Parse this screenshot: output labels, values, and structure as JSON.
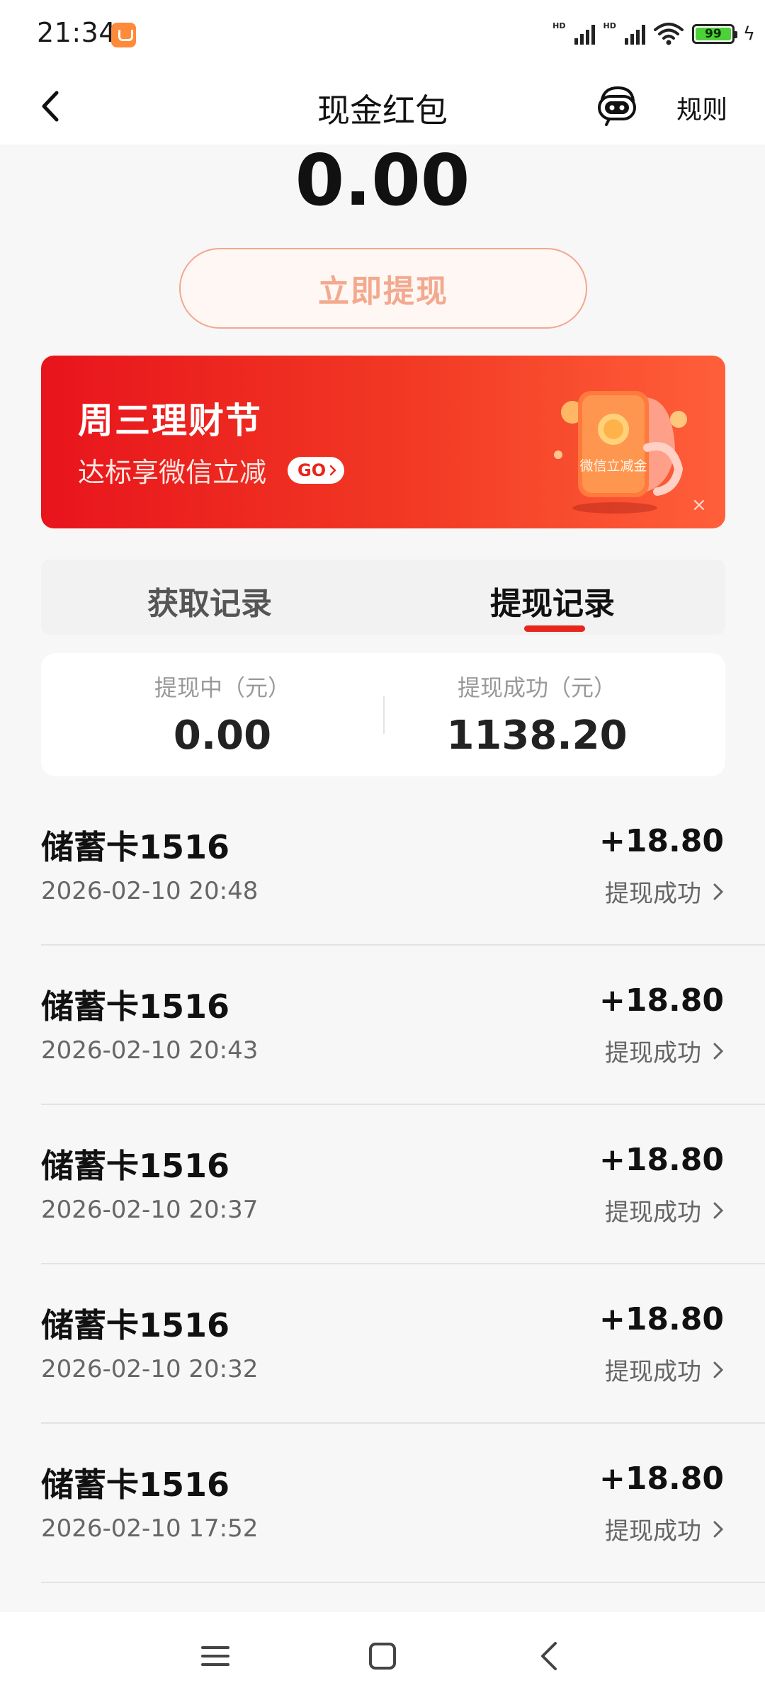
{
  "status_bar": {
    "time": "21:34",
    "hd1": "HD",
    "hd2": "HD",
    "battery": "99",
    "icons": [
      "app-notification-icon",
      "signal-icon",
      "signal-icon",
      "wifi-icon",
      "battery-icon",
      "charging-icon"
    ]
  },
  "header": {
    "title": "现金红包",
    "rules": "规则",
    "icons": [
      "back-arrow-icon",
      "robot-assistant-icon"
    ]
  },
  "balance": {
    "amount": "0.00",
    "withdraw_label": "立即提现"
  },
  "banner": {
    "title": "周三理财节",
    "subtitle": "达标享微信立减",
    "go_label": "GO",
    "art_label": "微信立减金",
    "close": "×"
  },
  "tabs": [
    {
      "label": "获取记录",
      "active": false
    },
    {
      "label": "提现记录",
      "active": true
    }
  ],
  "summary": {
    "pending_label": "提现中（元）",
    "pending_value": "0.00",
    "success_label": "提现成功（元）",
    "success_value": "1138.20"
  },
  "records": [
    {
      "card": "储蓄卡1516",
      "time": "2026-02-10 20:48",
      "amount": "+18.80",
      "status": "提现成功"
    },
    {
      "card": "储蓄卡1516",
      "time": "2026-02-10 20:43",
      "amount": "+18.80",
      "status": "提现成功"
    },
    {
      "card": "储蓄卡1516",
      "time": "2026-02-10 20:37",
      "amount": "+18.80",
      "status": "提现成功"
    },
    {
      "card": "储蓄卡1516",
      "time": "2026-02-10 20:32",
      "amount": "+18.80",
      "status": "提现成功"
    },
    {
      "card": "储蓄卡1516",
      "time": "2026-02-10 17:52",
      "amount": "+18.80",
      "status": "提现成功"
    }
  ],
  "colors": {
    "accent": "#e9261c",
    "banner_start": "#e8141c",
    "banner_end": "#ff5f3a",
    "withdraw_border": "#f3a78f"
  }
}
